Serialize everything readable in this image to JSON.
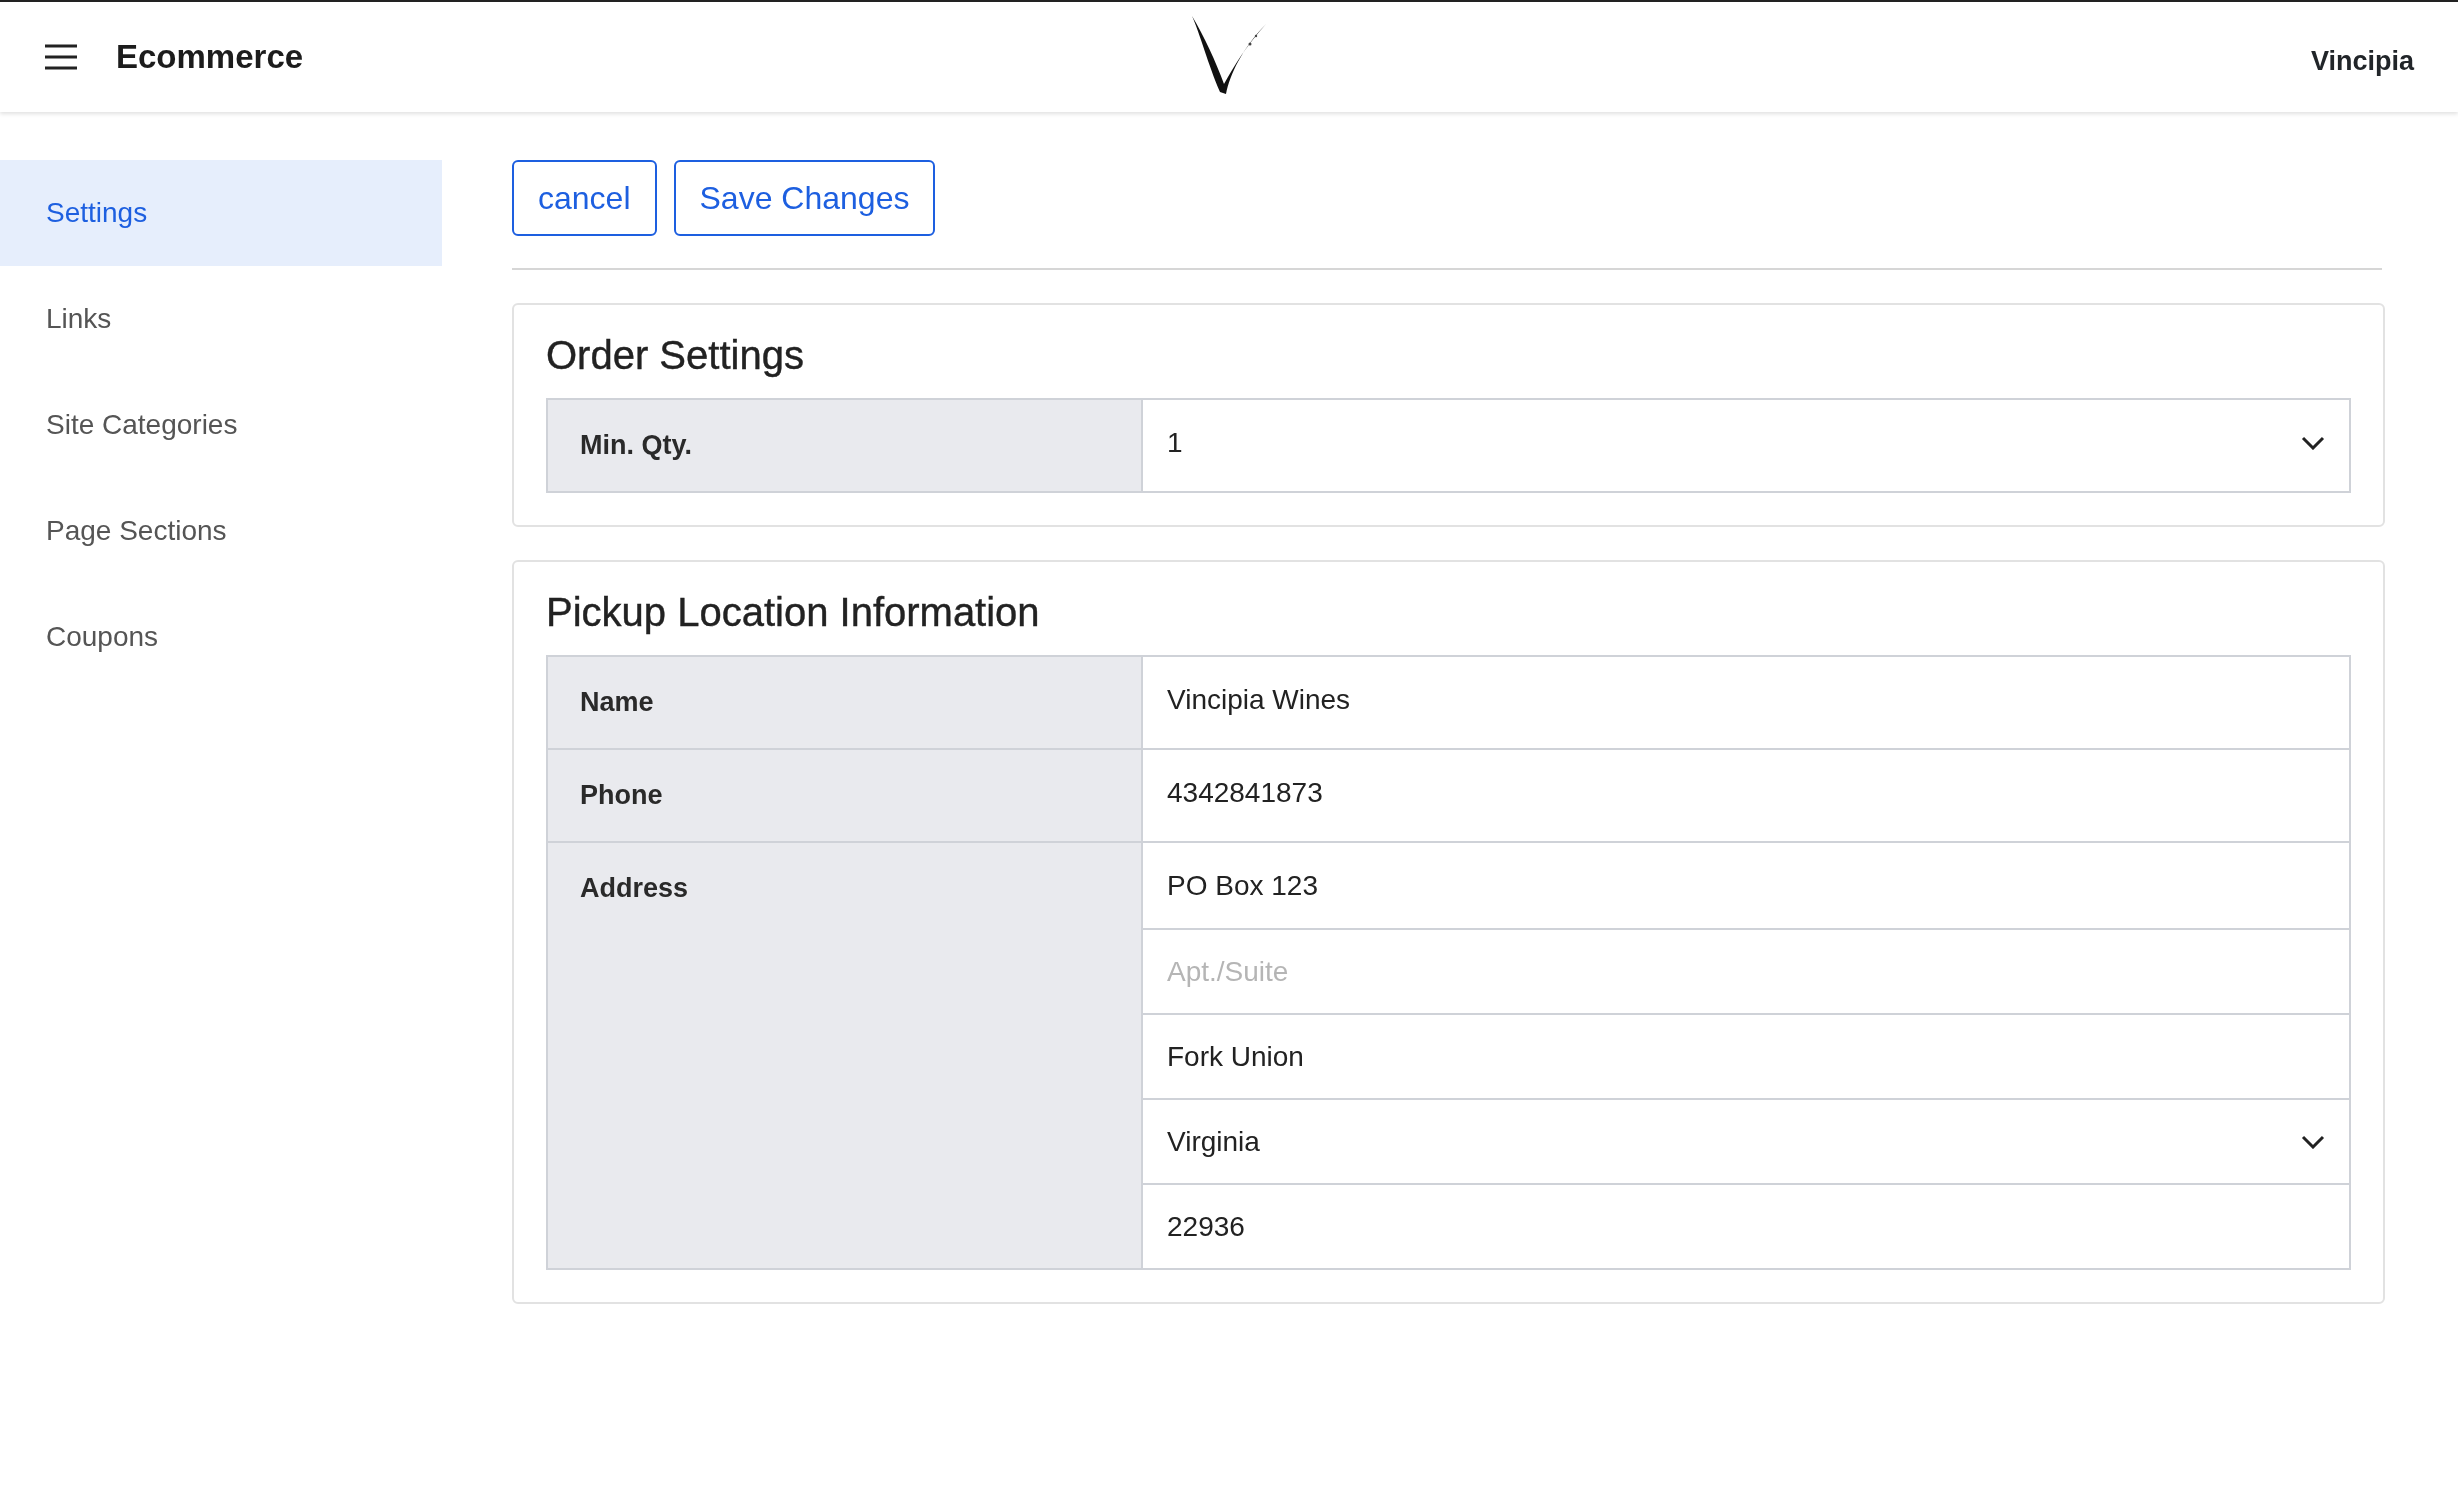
{
  "header": {
    "app_title": "Ecommerce",
    "user": "Vincipia"
  },
  "sidebar": {
    "items": [
      {
        "label": "Settings",
        "selected": true
      },
      {
        "label": "Links",
        "selected": false
      },
      {
        "label": "Site Categories",
        "selected": false
      },
      {
        "label": "Page Sections",
        "selected": false
      },
      {
        "label": "Coupons",
        "selected": false
      }
    ]
  },
  "actions": [
    "cancel",
    "Save Changes"
  ],
  "sections": [
    {
      "title": "Order Settings",
      "rows": [
        {
          "label": "Min. Qty.",
          "fields": [
            {
              "kind": "select",
              "value": "1"
            }
          ]
        }
      ]
    },
    {
      "title": "Pickup Location Information",
      "rows": [
        {
          "label": "Name",
          "fields": [
            {
              "kind": "text",
              "value": "Vincipia Wines"
            }
          ]
        },
        {
          "label": "Phone",
          "fields": [
            {
              "kind": "text",
              "value": "4342841873"
            }
          ]
        },
        {
          "label": "Address",
          "fields": [
            {
              "kind": "text",
              "value": "PO Box 123"
            },
            {
              "kind": "text",
              "placeholder": "Apt./Suite"
            },
            {
              "kind": "text",
              "value": "Fork Union"
            },
            {
              "kind": "select",
              "value": "Virginia"
            },
            {
              "kind": "text",
              "value": "22936"
            }
          ]
        }
      ]
    }
  ]
}
